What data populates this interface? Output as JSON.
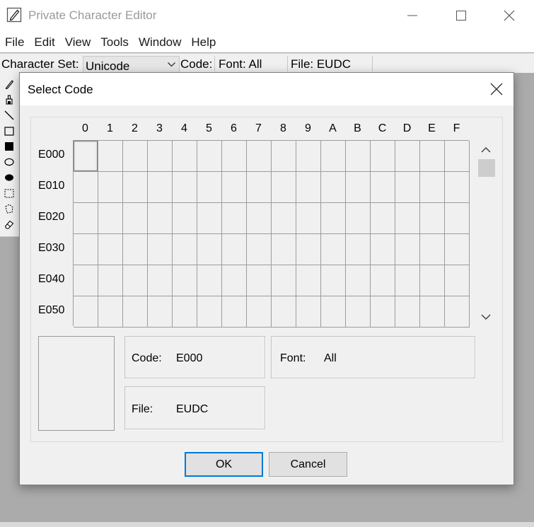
{
  "window": {
    "title": "Private Character Editor",
    "icon": "pen-and-paper-icon"
  },
  "menu": [
    "File",
    "Edit",
    "View",
    "Tools",
    "Window",
    "Help"
  ],
  "character_bar": {
    "character_set_label": "Character Set:",
    "character_set_value": "Unicode",
    "code_label": "Code:",
    "font_label": "Font: All",
    "file_label": "File: EUDC"
  },
  "tools": [
    "pencil-icon",
    "brush-icon",
    "line-icon",
    "hollow-rectangle-icon",
    "filled-rectangle-icon",
    "hollow-ellipse-icon",
    "filled-ellipse-icon",
    "rectangular-selection-icon",
    "freeform-selection-icon",
    "eraser-icon"
  ],
  "dialog": {
    "title": "Select Code",
    "columns": [
      "0",
      "1",
      "2",
      "3",
      "4",
      "5",
      "6",
      "7",
      "8",
      "9",
      "A",
      "B",
      "C",
      "D",
      "E",
      "F"
    ],
    "rows": [
      "E000",
      "E010",
      "E020",
      "E030",
      "E040",
      "E050"
    ],
    "selected_code": "E000",
    "code_label": "Code:",
    "code_value": "E000",
    "font_label": "Font:",
    "font_value": "All",
    "file_label": "File:",
    "file_value": "EUDC",
    "ok_label": "OK",
    "cancel_label": "Cancel"
  },
  "colors": {
    "dialog_background": "#f0f0f0",
    "default_button_border": "#0078d7",
    "grid_line": "#9d9d9d",
    "workspace": "#ababab"
  }
}
